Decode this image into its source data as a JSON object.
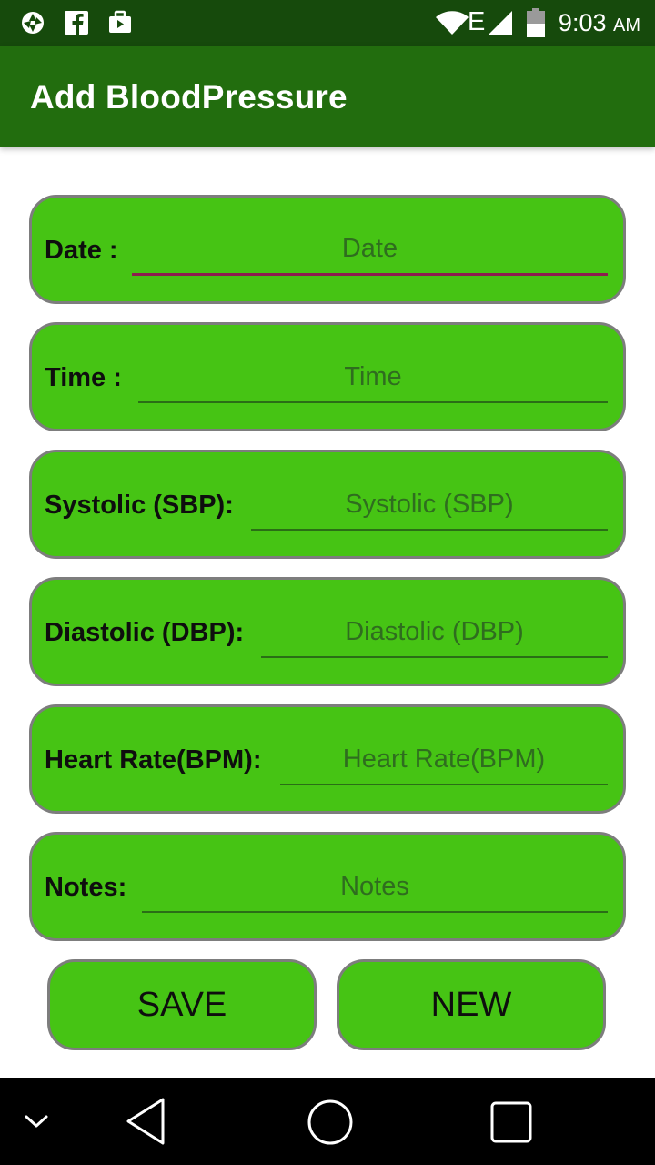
{
  "status_bar": {
    "icons": [
      "aperture-icon",
      "facebook-icon",
      "briefcase-icon",
      "wifi-icon",
      "network-e-icon",
      "signal-icon",
      "battery-icon"
    ],
    "network_type": "E",
    "time": "9:03",
    "ampm": "AM"
  },
  "app_bar": {
    "title": "Add BloodPressure",
    "color": "#226d0e"
  },
  "form": {
    "fields": [
      {
        "label": "Date :",
        "placeholder": "Date",
        "value": ""
      },
      {
        "label": "Time :",
        "placeholder": "Time",
        "value": ""
      },
      {
        "label": "Systolic (SBP):",
        "placeholder": "Systolic (SBP)",
        "value": ""
      },
      {
        "label": "Diastolic (DBP):",
        "placeholder": "Diastolic (DBP)",
        "value": ""
      },
      {
        "label": "Heart Rate(BPM):",
        "placeholder": "Heart Rate(BPM)",
        "value": ""
      },
      {
        "label": "Notes:",
        "placeholder": "Notes",
        "value": ""
      }
    ],
    "card_color": "#46c414",
    "focus_underline_color": "#8c1e4f"
  },
  "buttons": {
    "save": "SAVE",
    "new": "NEW"
  },
  "nav_bar": {
    "icons": [
      "chevron-down-icon",
      "back-icon",
      "home-icon",
      "recents-icon"
    ]
  }
}
